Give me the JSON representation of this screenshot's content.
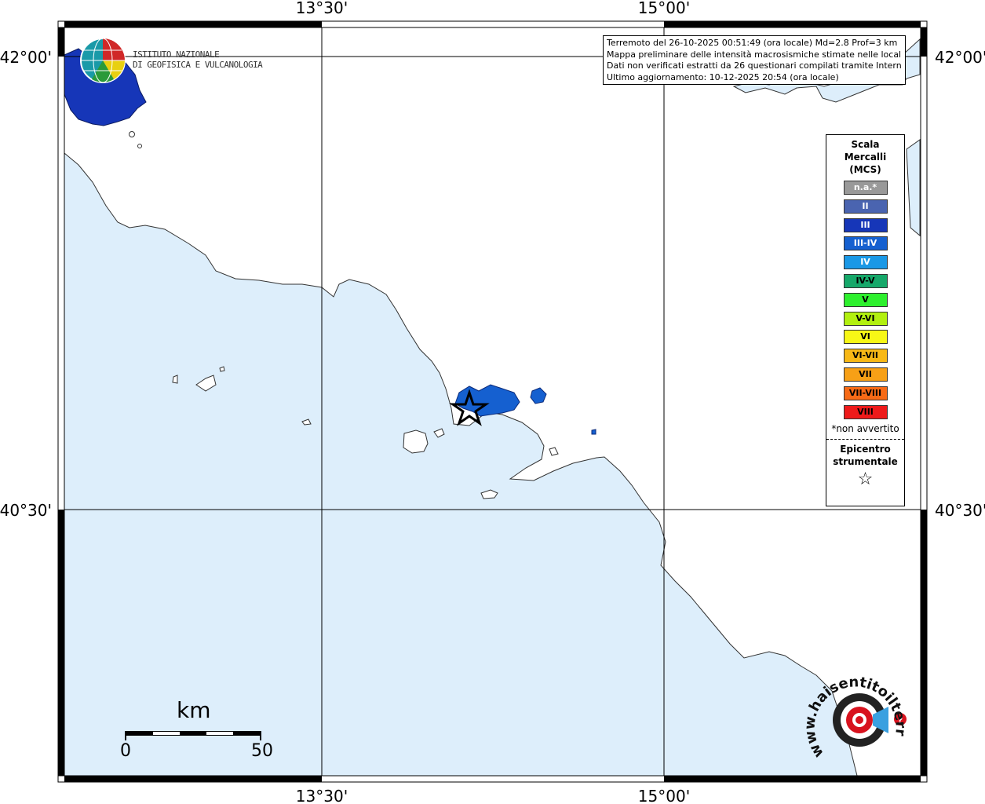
{
  "coords": {
    "lon_left": "13°30'",
    "lon_right": "15°00'",
    "lat_top": "42°00'",
    "lat_bottom": "40°30'"
  },
  "info": {
    "line1": "Terremoto del 26-10-2025 00:51:49 (ora locale) Md=2.8 Prof=3 km",
    "line2": "Mappa preliminare delle intensità macrosismiche stimate nelle località",
    "line3": "Dati non verificati estratti da 26 questionari compilati tramite Internet.",
    "line4": "Ultimo aggiornamento: 10-12-2025 20:54 (ora locale)"
  },
  "logo": {
    "line1": "ISTITUTO NAZIONALE",
    "line2": "DI GEOFISICA E VULCANOLOGIA"
  },
  "legend": {
    "title": "Scala Mercalli (MCS)",
    "items": [
      {
        "label": "n.a.*",
        "color": "#999999"
      },
      {
        "label": "II",
        "color": "#4a64b0"
      },
      {
        "label": "III",
        "color": "#1636b8"
      },
      {
        "label": "III-IV",
        "color": "#1560d0"
      },
      {
        "label": "IV",
        "color": "#1a98e6"
      },
      {
        "label": "IV-V",
        "color": "#16a86a"
      },
      {
        "label": "V",
        "color": "#2ef02e"
      },
      {
        "label": "V-VI",
        "color": "#b2f010"
      },
      {
        "label": "VI",
        "color": "#f7f716"
      },
      {
        "label": "VI-VII",
        "color": "#f7b816"
      },
      {
        "label": "VII",
        "color": "#f7a016"
      },
      {
        "label": "VII-VIII",
        "color": "#f76a16"
      },
      {
        "label": "VIII",
        "color": "#ee1a1a"
      }
    ],
    "note": "*non avvertito",
    "epicenter_label": "Epicentro strumentale",
    "epicenter_icon": "star-icon"
  },
  "scale": {
    "unit": "km",
    "start": "0",
    "end": "50"
  },
  "watermark": "www.haisentitoilterremoto.it",
  "colors": {
    "sea": "#ddeefb",
    "land": "#ffffff",
    "intensity_III": "#1636b8",
    "intensity_III_IV": "#1560d0"
  }
}
